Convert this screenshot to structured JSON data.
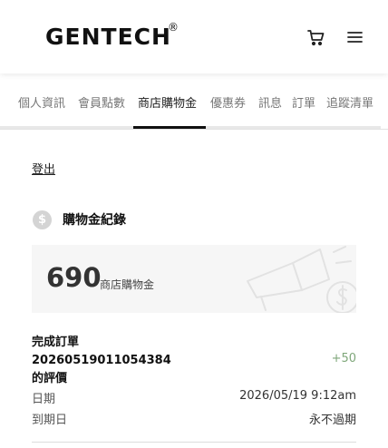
{
  "header": {
    "logo_text": "GENTECH",
    "logo_reg": "®",
    "cart_icon": "cart-icon",
    "menu_icon": "hamburger-menu-icon"
  },
  "tabs": [
    {
      "label": "個人資訊",
      "active": false
    },
    {
      "label": "會員點數",
      "active": false
    },
    {
      "label": "商店購物金",
      "active": true
    },
    {
      "label": "優惠券",
      "active": false
    },
    {
      "label": "訊息",
      "active": false
    },
    {
      "label": "訂單",
      "active": false
    },
    {
      "label": "追蹤清單",
      "active": false
    }
  ],
  "logout_label": "登出",
  "section": {
    "icon": "dollar-coin-icon",
    "icon_glyph": "$",
    "title": "購物金紀錄"
  },
  "balance": {
    "value": "690",
    "label": "商店購物金"
  },
  "record": {
    "title_line1": "完成訂單",
    "title_line2": "20260519011054384",
    "title_line3": "的評價",
    "amount": "+50",
    "date_label": "日期",
    "date_value": "2026/05/19 9:12am",
    "expiry_label": "到期日",
    "expiry_value": "永不過期"
  },
  "colors": {
    "accent": "#111111",
    "positive_amount": "#7fa77a",
    "card_bg": "#f6f6f6"
  }
}
